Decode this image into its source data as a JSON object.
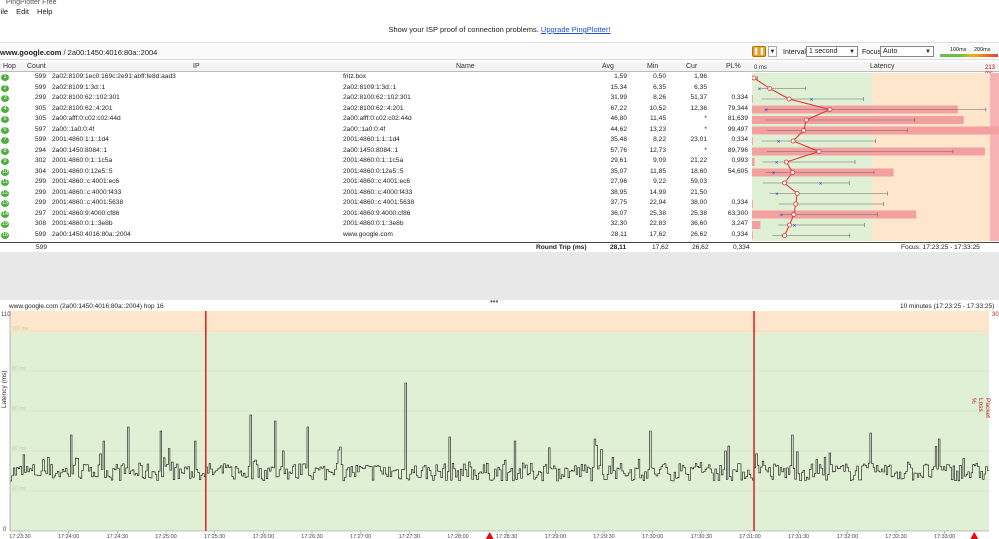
{
  "window": {
    "title": "PingPlotter Free"
  },
  "menu": [
    "File",
    "Edit",
    "Help"
  ],
  "banner": {
    "text": "Show your ISP proof of connection problems.",
    "link": "Upgrade PingPlotter!"
  },
  "target": {
    "host": "www.google.com",
    "ip": " / 2a00:1450:4016:80a::2004"
  },
  "toolbar": {
    "interval_label": "Interval",
    "interval_value": "1 second",
    "focus_label": "Focus",
    "focus_value": "Auto",
    "scale_100": "100ms",
    "scale_200": "200ms"
  },
  "columns": [
    "Hop",
    "Count",
    "IP",
    "Name",
    "Avg",
    "Min",
    "Cur",
    "PL%",
    "Latency"
  ],
  "latency_header": {
    "left": "0 ms",
    "right": "213 ms"
  },
  "hops": [
    {
      "hop": "1",
      "count": "599",
      "ip": "2a02:8109:1ec0:169c:2e91:abff:fe8d:aad3",
      "name": "fritz.box",
      "avg": "1,59",
      "min": "0,50",
      "cur": "1,96",
      "pl": "",
      "lat": 1.59,
      "pln": 0
    },
    {
      "hop": "2",
      "count": "599",
      "ip": "2a02:8109:1:3d::1",
      "name": "2a02:8109:1:3d::1",
      "avg": "15,34",
      "min": "6,35",
      "cur": "6,35",
      "pl": "",
      "lat": 15.34,
      "pln": 0
    },
    {
      "hop": "3",
      "count": "299",
      "ip": "2a02:8100:62::102:301",
      "name": "2a02:8100:62::102:301",
      "avg": "31,99",
      "min": "8,26",
      "cur": "51,37",
      "pl": "0,334",
      "lat": 31.99,
      "pln": 0.334
    },
    {
      "hop": "4",
      "count": "305",
      "ip": "2a02:8100:62::4:201",
      "name": "2a02:8100:62::4:201",
      "avg": "67,22",
      "min": "10,52",
      "cur": "12,36",
      "pl": "79,344",
      "lat": 67.22,
      "pln": 79.344
    },
    {
      "hop": "5",
      "count": "305",
      "ip": "2a00:afff:0:c02:c02:44d",
      "name": "2a00:afff:0:c02:c02:44d",
      "avg": "46,80",
      "min": "11,45",
      "cur": "*",
      "pl": "81,639",
      "lat": 46.8,
      "pln": 81.639
    },
    {
      "hop": "6",
      "count": "597",
      "ip": "2a00::1a0:0:4f",
      "name": "2a00::1a0:0:4f",
      "avg": "44,62",
      "min": "13,23",
      "cur": "*",
      "pl": "99,497",
      "lat": 44.62,
      "pln": 99.497
    },
    {
      "hop": "7",
      "count": "599",
      "ip": "2001:4860:1:1::1d4",
      "name": "2001:4860:1:1::1d4",
      "avg": "35,48",
      "min": "8,22",
      "cur": "23,01",
      "pl": "0,334",
      "lat": 35.48,
      "pln": 0.334
    },
    {
      "hop": "8",
      "count": "294",
      "ip": "2a00:1450:8084::1",
      "name": "2a00:1450:8084::1",
      "avg": "57,76",
      "min": "12,73",
      "cur": "*",
      "pl": "89,796",
      "lat": 57.76,
      "pln": 89.796
    },
    {
      "hop": "9",
      "count": "302",
      "ip": "2001:4860:0:1::1c5a",
      "name": "2001:4860:0:1::1c5a",
      "avg": "29,61",
      "min": "9,09",
      "cur": "21,22",
      "pl": "0,993",
      "lat": 29.61,
      "pln": 0.993
    },
    {
      "hop": "10",
      "count": "304",
      "ip": "2001:4860:0:12e5::5",
      "name": "2001:4860:0:12e5::5",
      "avg": "35,07",
      "min": "11,85",
      "cur": "18,60",
      "pl": "54,605",
      "lat": 35.07,
      "pln": 54.605
    },
    {
      "hop": "11",
      "count": "299",
      "ip": "2001:4860::c:4001:ec6",
      "name": "2001:4860::c:4001:ec6",
      "avg": "27,96",
      "min": "9,22",
      "cur": "59,03",
      "pl": "",
      "lat": 27.96,
      "pln": 0
    },
    {
      "hop": "12",
      "count": "299",
      "ip": "2001:4860::c:4000:f433",
      "name": "2001:4860::c:4000:f433",
      "avg": "38,95",
      "min": "14,99",
      "cur": "21,50",
      "pl": "",
      "lat": 38.95,
      "pln": 0
    },
    {
      "hop": "13",
      "count": "299",
      "ip": "2001:4860::c:4001:5638",
      "name": "2001:4860::c:4001:5638",
      "avg": "37,75",
      "min": "22,94",
      "cur": "38,00",
      "pl": "0,334",
      "lat": 37.75,
      "pln": 0.334
    },
    {
      "hop": "14",
      "count": "297",
      "ip": "2001:4860:9:4000:cf86",
      "name": "2001:4860:9:4000:cf86",
      "avg": "36,07",
      "min": "25,38",
      "cur": "25,38",
      "pl": "63,300",
      "lat": 36.07,
      "pln": 63.3
    },
    {
      "hop": "15",
      "count": "308",
      "ip": "2001:4860:0:1::3e8b",
      "name": "2001:4860:0:1::3e8b",
      "avg": "32,30",
      "min": "22,83",
      "cur": "36,60",
      "pl": "3,247",
      "lat": 32.3,
      "pln": 3.247
    },
    {
      "hop": "16",
      "count": "599",
      "ip": "2a00:1450:4016:80a::2004",
      "name": "www.google.com",
      "avg": "28,11",
      "min": "17,62",
      "cur": "26,62",
      "pl": "0,334",
      "lat": 28.11,
      "pln": 0.334
    }
  ],
  "summary": {
    "count": "599",
    "label": "Round Trip (ms)",
    "avg": "28,11",
    "min": "17,62",
    "cur": "26,62",
    "pl": "0,334",
    "focus": "Focus: 17:23:25 - 17:33:25"
  },
  "graph": {
    "title": "www.google.com (2a00:1450:4016:80a::2004) hop 16",
    "range": "10 minutes (17:23:25 - 17:33:25)",
    "y_label": "Latency (ms)",
    "y2_label": "Packet Loss %",
    "y_top": "110",
    "y2_top": "30",
    "y_ticks": [
      "100 ms",
      "80 ms",
      "60 ms",
      "40 ms",
      "20 ms"
    ],
    "y_bottom": "0",
    "x_ticks": [
      "17:23:30",
      "17:24:00",
      "17:24:30",
      "17:25:00",
      "17:25:30",
      "17:26:00",
      "17:26:30",
      "17:27:00",
      "17:27:30",
      "17:28:00",
      "17:28:30",
      "17:29:00",
      "17:29:30",
      "17:30:00",
      "17:30:30",
      "17:31:00",
      "17:31:30",
      "17:32:00",
      "17:32:30",
      "17:33:00"
    ],
    "loss_lines": [
      0.2,
      0.76
    ],
    "loss_markers": [
      0.49,
      0.985
    ]
  },
  "colors": {
    "green": "#dff0d4",
    "orange": "#fde6cc",
    "red": "#f7b3b3",
    "plot_line": "#e03030",
    "hop_badge": "#4caf3c"
  }
}
